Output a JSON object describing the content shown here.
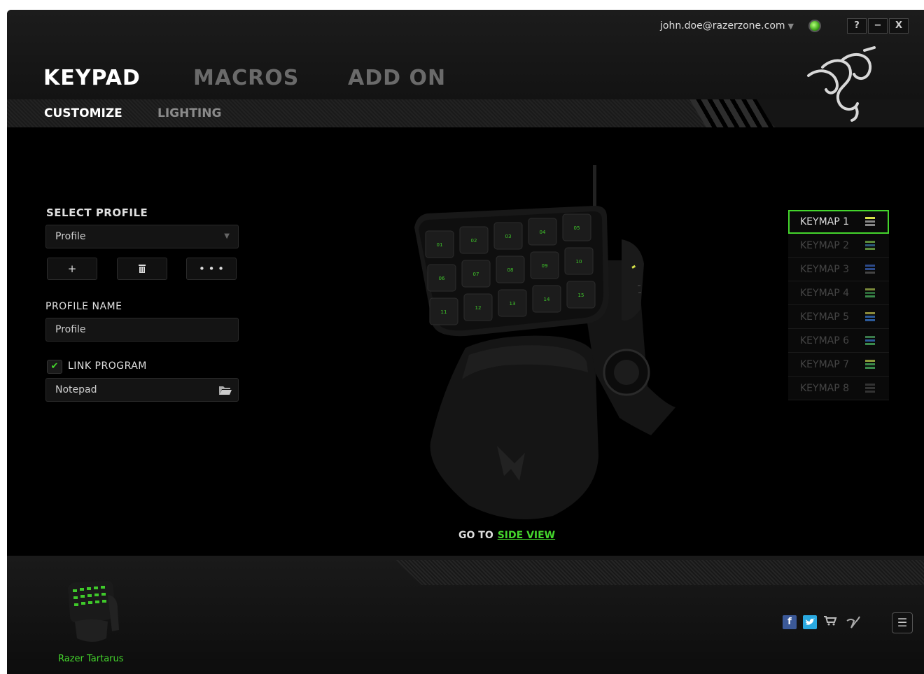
{
  "header": {
    "tabs": [
      {
        "label": "KEYPAD",
        "active": true
      },
      {
        "label": "MACROS",
        "active": false
      },
      {
        "label": "ADD ON",
        "active": false
      }
    ],
    "subtabs": [
      {
        "label": "CUSTOMIZE",
        "active": true
      },
      {
        "label": "LIGHTING",
        "active": false
      }
    ],
    "user_email": "john.doe@razerzone.com",
    "window_buttons": {
      "help": "?",
      "minimize": "−",
      "close": "X"
    }
  },
  "profile": {
    "select_label": "SELECT PROFILE",
    "selected": "Profile",
    "buttons": {
      "add": "+",
      "more": "• • •"
    },
    "name_label": "PROFILE NAME",
    "name_value": "Profile",
    "link_program_label": "LINK PROGRAM",
    "link_program_checked": true,
    "program": "Notepad"
  },
  "keypad_keys": [
    "01",
    "02",
    "03",
    "04",
    "05",
    "06",
    "07",
    "08",
    "09",
    "10",
    "11",
    "12",
    "13",
    "14",
    "15"
  ],
  "keymaps": [
    {
      "label": "KEYMAP 1",
      "active": true
    },
    {
      "label": "KEYMAP 2",
      "active": false
    },
    {
      "label": "KEYMAP 3",
      "active": false
    },
    {
      "label": "KEYMAP 4",
      "active": false
    },
    {
      "label": "KEYMAP 5",
      "active": false
    },
    {
      "label": "KEYMAP 6",
      "active": false
    },
    {
      "label": "KEYMAP 7",
      "active": false
    },
    {
      "label": "KEYMAP 8",
      "active": false
    }
  ],
  "goto": {
    "prefix": "GO TO",
    "link": "SIDE VIEW"
  },
  "footer": {
    "device_name": "Razer Tartarus"
  },
  "colors": {
    "accent": "#44d62c",
    "background": "#000000"
  }
}
